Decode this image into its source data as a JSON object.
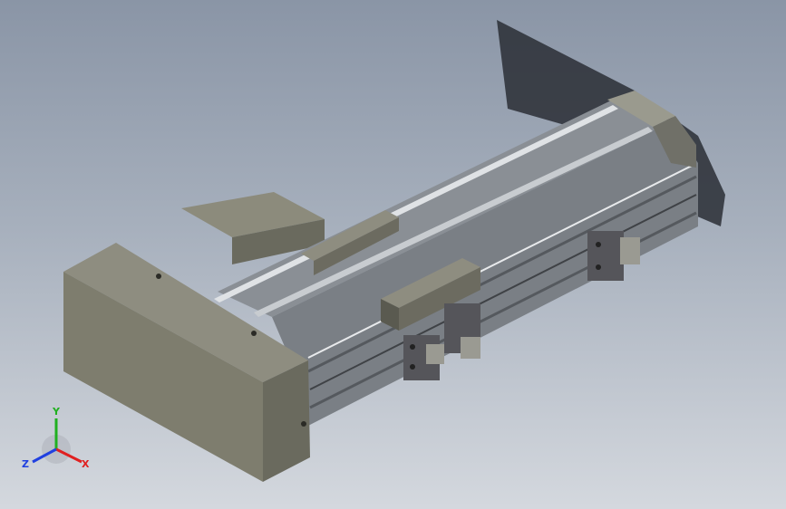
{
  "viewport": {
    "background_top": "#8a95a6",
    "background_bottom": "#d4d8de"
  },
  "model": {
    "icon": "linear-actuator-module",
    "face_color": "#7e7d6e",
    "rail_color": "#9aa0a6",
    "highlight_color": "#e6e8ea"
  },
  "triad": {
    "x_label": "X",
    "y_label": "Y",
    "z_label": "Z",
    "x_color": "#e02020",
    "y_color": "#20b020",
    "z_color": "#2040e0"
  }
}
